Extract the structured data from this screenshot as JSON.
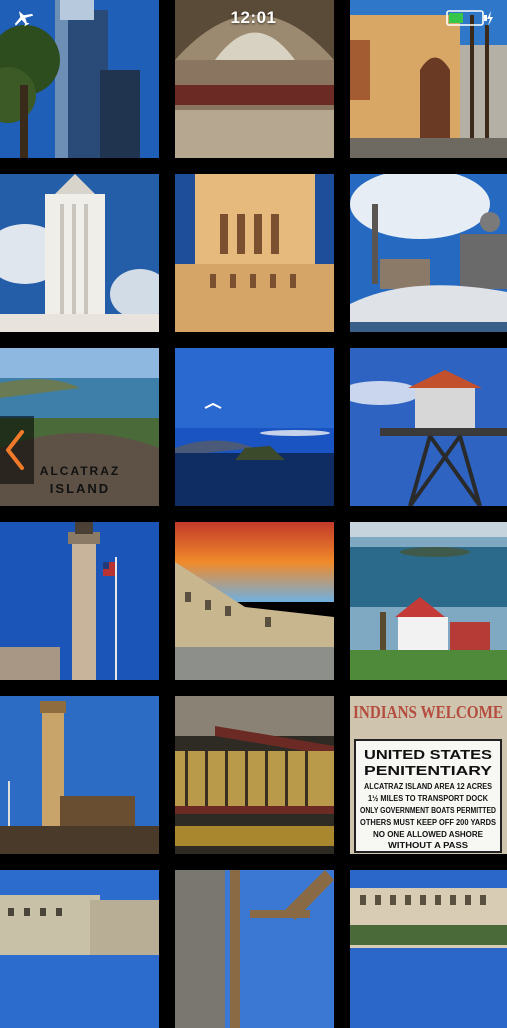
{
  "status_bar": {
    "time": "12:01",
    "icons": [
      "airplane-mode-icon",
      "battery-charging-icon"
    ],
    "battery_color": "#35c64a"
  },
  "navigation": {
    "icon": "chevron-left-icon",
    "accent": "#f07a2a"
  },
  "photos": [
    {
      "name": "photo-downtown-towers"
    },
    {
      "name": "photo-train-station-hall"
    },
    {
      "name": "photo-mission-arch-building"
    },
    {
      "name": "photo-city-hall-tower"
    },
    {
      "name": "photo-city-hall-closeup"
    },
    {
      "name": "photo-alcatraz-smokestack"
    },
    {
      "name": "photo-alcatraz-island-marker",
      "caption_lines": [
        "ALCATRAZ",
        "ISLAND"
      ]
    },
    {
      "name": "photo-alcatraz-bay-view"
    },
    {
      "name": "photo-guard-tower"
    },
    {
      "name": "photo-lighthouse-flag"
    },
    {
      "name": "photo-prison-yard-sunset"
    },
    {
      "name": "photo-island-house"
    },
    {
      "name": "photo-lighthouse-buildings"
    },
    {
      "name": "photo-cellblock-interior"
    },
    {
      "name": "photo-penitentiary-sign",
      "banner": "INDIANS WELCOME",
      "sign_lines": [
        "UNITED STATES",
        "PENITENTIARY",
        "ALCATRAZ ISLAND  AREA 12 ACRES",
        "1½ MILES TO TRANSPORT DOCK",
        "ONLY GOVERNMENT BOATS PERMITTED",
        "OTHERS MUST KEEP OFF 200 YARDS",
        "NO ONE ALLOWED ASHORE",
        "WITHOUT A PASS"
      ]
    },
    {
      "name": "photo-barracks-building"
    },
    {
      "name": "photo-ruined-wall"
    },
    {
      "name": "photo-cellhouse-exterior"
    }
  ]
}
